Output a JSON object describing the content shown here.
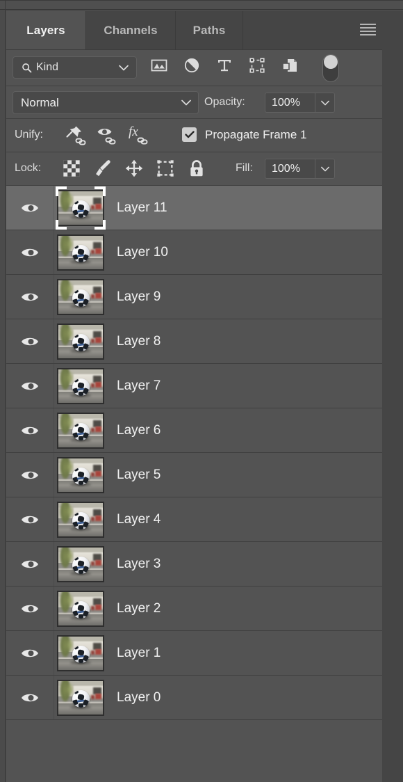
{
  "panel": {
    "tabs": [
      {
        "label": "Layers",
        "active": true
      },
      {
        "label": "Channels",
        "active": false
      },
      {
        "label": "Paths",
        "active": false
      }
    ],
    "menu_icon": "hamburger-menu-icon"
  },
  "filter": {
    "kind_label": "Kind",
    "search_icon": "search-icon",
    "dropdown_icon": "chevron-down-icon",
    "type_filters": [
      {
        "name": "filter-pixel-layers-icon"
      },
      {
        "name": "filter-adjustment-layers-icon"
      },
      {
        "name": "filter-type-layers-icon"
      },
      {
        "name": "filter-shape-layers-icon"
      },
      {
        "name": "filter-smart-object-layers-icon"
      }
    ],
    "toggle_icon": "filter-enable-toggle",
    "toggle_on": true
  },
  "blend": {
    "mode": "Normal",
    "opacity_label": "Opacity:",
    "opacity_value": "100%",
    "dropdown_icon": "chevron-down-icon"
  },
  "unify": {
    "label": "Unify:",
    "icons": [
      {
        "name": "unify-position-icon"
      },
      {
        "name": "unify-visibility-icon"
      },
      {
        "name": "unify-style-icon"
      }
    ],
    "propagate_label": "Propagate Frame 1",
    "propagate_checked": true
  },
  "lock": {
    "label": "Lock:",
    "icons": [
      {
        "name": "lock-transparent-pixels-icon"
      },
      {
        "name": "lock-image-pixels-icon"
      },
      {
        "name": "lock-position-icon"
      },
      {
        "name": "lock-artboard-nesting-icon"
      },
      {
        "name": "lock-all-icon"
      }
    ],
    "fill_label": "Fill:",
    "fill_value": "100%"
  },
  "layers": [
    {
      "name": "Layer 11",
      "visible": true,
      "selected": true
    },
    {
      "name": "Layer 10",
      "visible": true,
      "selected": false
    },
    {
      "name": "Layer 9",
      "visible": true,
      "selected": false
    },
    {
      "name": "Layer 8",
      "visible": true,
      "selected": false
    },
    {
      "name": "Layer 7",
      "visible": true,
      "selected": false
    },
    {
      "name": "Layer 6",
      "visible": true,
      "selected": false
    },
    {
      "name": "Layer 5",
      "visible": true,
      "selected": false
    },
    {
      "name": "Layer 4",
      "visible": true,
      "selected": false
    },
    {
      "name": "Layer 3",
      "visible": true,
      "selected": false
    },
    {
      "name": "Layer 2",
      "visible": true,
      "selected": false
    },
    {
      "name": "Layer 1",
      "visible": true,
      "selected": false
    },
    {
      "name": "Layer 0",
      "visible": true,
      "selected": false
    }
  ],
  "thumbnail_subject": "soccer ball on a street",
  "colors": {
    "panel_bg": "#535353",
    "tabbar_bg": "#454545",
    "row_selected": "#6b6b6b",
    "divider": "#3f3f3f",
    "text": "#f1f1f1"
  }
}
